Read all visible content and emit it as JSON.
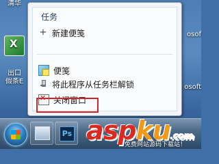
{
  "menu": {
    "section_title": "任务",
    "items": [
      {
        "label": "新建便笺",
        "icon": "plus-icon"
      },
      {
        "label": "便笺",
        "icon": "sticky-notes-icon"
      },
      {
        "label": "将此程序从任务栏解锁",
        "icon": "pin-icon"
      },
      {
        "label": "关闭窗口",
        "icon": "close-window-icon"
      }
    ]
  },
  "desktop": {
    "icon_top_label": "清华",
    "icon_label_1": "出口",
    "icon_label_2": "假条E",
    "right_label_1": "osof",
    "right_label_2": "osoft"
  },
  "taskbar": {
    "ps_label": "Ps"
  },
  "watermark": {
    "main_a": "asp",
    "main_b": "ku",
    "suffix": ".com",
    "sub": "免费网站源码下载站！"
  },
  "colors": {
    "highlight": "#d3242a",
    "watermark_red": "#d82a20",
    "watermark_orange": "#f29a18"
  }
}
